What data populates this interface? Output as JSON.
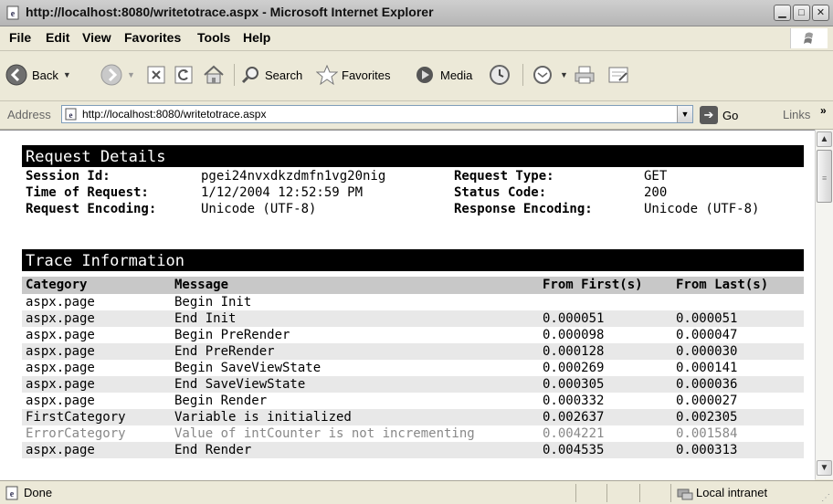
{
  "window": {
    "title": "http://localhost:8080/writetotrace.aspx - Microsoft Internet Explorer",
    "controls": [
      "minimize",
      "maximize",
      "close"
    ]
  },
  "menu": [
    "File",
    "Edit",
    "View",
    "Favorites",
    "Tools",
    "Help"
  ],
  "toolbar": {
    "back_label": "Back",
    "search_label": "Search",
    "favorites_label": "Favorites",
    "media_label": "Media"
  },
  "address": {
    "label": "Address",
    "url": "http://localhost:8080/writetotrace.aspx",
    "go_label": "Go",
    "links_label": "Links",
    "links_chevron": "»"
  },
  "request_details": {
    "header": "Request Details",
    "session_id_label": "Session Id:",
    "session_id": "pgei24nvxdkzdmfn1vg20nig",
    "request_type_label": "Request Type:",
    "request_type": "GET",
    "time_label": "Time of Request:",
    "time": "1/12/2004 12:52:59 PM",
    "status_code_label": "Status Code:",
    "status_code": "200",
    "req_encoding_label": "Request Encoding:",
    "req_encoding": "Unicode (UTF-8)",
    "resp_encoding_label": "Response Encoding:",
    "resp_encoding": "Unicode (UTF-8)"
  },
  "trace": {
    "header": "Trace Information",
    "columns": [
      "Category",
      "Message",
      "From First(s)",
      "From Last(s)"
    ],
    "rows": [
      {
        "category": "aspx.page",
        "message": "Begin Init",
        "from_first": "",
        "from_last": "",
        "warning": false
      },
      {
        "category": "aspx.page",
        "message": "End Init",
        "from_first": "0.000051",
        "from_last": "0.000051",
        "warning": false
      },
      {
        "category": "aspx.page",
        "message": "Begin PreRender",
        "from_first": "0.000098",
        "from_last": "0.000047",
        "warning": false
      },
      {
        "category": "aspx.page",
        "message": "End PreRender",
        "from_first": "0.000128",
        "from_last": "0.000030",
        "warning": false
      },
      {
        "category": "aspx.page",
        "message": "Begin SaveViewState",
        "from_first": "0.000269",
        "from_last": "0.000141",
        "warning": false
      },
      {
        "category": "aspx.page",
        "message": "End SaveViewState",
        "from_first": "0.000305",
        "from_last": "0.000036",
        "warning": false
      },
      {
        "category": "aspx.page",
        "message": "Begin Render",
        "from_first": "0.000332",
        "from_last": "0.000027",
        "warning": false
      },
      {
        "category": "FirstCategory",
        "message": "Variable is initialized",
        "from_first": "0.002637",
        "from_last": "0.002305",
        "warning": false
      },
      {
        "category": "ErrorCategory",
        "message": "Value of intCounter is not incrementing",
        "from_first": "0.004221",
        "from_last": "0.001584",
        "warning": true
      },
      {
        "category": "aspx.page",
        "message": "End Render",
        "from_first": "0.004535",
        "from_last": "0.000313",
        "warning": false
      }
    ]
  },
  "status": {
    "text": "Done",
    "zone": "Local intranet"
  },
  "colors": {
    "section_header_bg": "#000000",
    "table_header_bg": "#c8c8c8",
    "alt_row_bg": "#e8e8e8",
    "warning_text": "#888888",
    "chrome_bg": "#ece9d8"
  },
  "icons": [
    "ie-page-icon",
    "back-arrow-icon",
    "forward-arrow-icon",
    "stop-icon",
    "refresh-icon",
    "home-icon",
    "search-icon",
    "favorites-star-icon",
    "media-icon",
    "history-icon",
    "mail-icon",
    "print-icon",
    "edit-icon",
    "go-arrow-icon",
    "local-intranet-icon"
  ]
}
